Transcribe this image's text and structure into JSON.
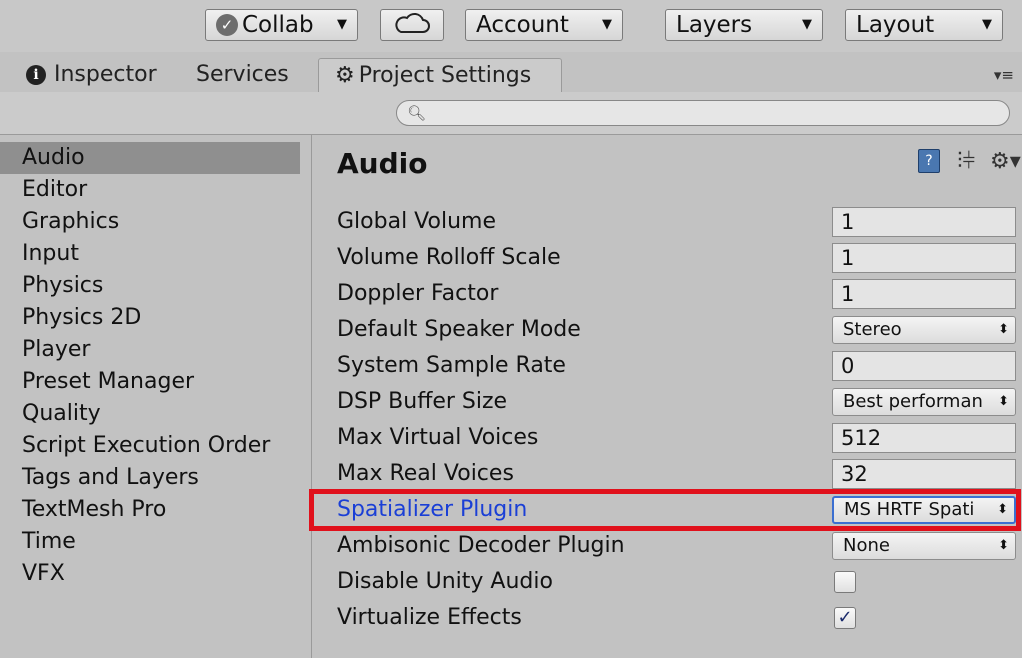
{
  "toolbar": {
    "collab_label": "Collab",
    "account_label": "Account",
    "layers_label": "Layers",
    "layout_label": "Layout"
  },
  "tabs": {
    "inspector": "Inspector",
    "services": "Services",
    "project_settings": "Project Settings"
  },
  "sidebar": {
    "items": [
      "Audio",
      "Editor",
      "Graphics",
      "Input",
      "Physics",
      "Physics 2D",
      "Player",
      "Preset Manager",
      "Quality",
      "Script Execution Order",
      "Tags and Layers",
      "TextMesh Pro",
      "Time",
      "VFX"
    ],
    "selected": "Audio"
  },
  "main": {
    "title": "Audio",
    "rows": {
      "global_volume": {
        "label": "Global Volume",
        "value": "1"
      },
      "volume_rolloff_scale": {
        "label": "Volume Rolloff Scale",
        "value": "1"
      },
      "doppler_factor": {
        "label": "Doppler Factor",
        "value": "1"
      },
      "default_speaker_mode": {
        "label": "Default Speaker Mode",
        "value": "Stereo"
      },
      "system_sample_rate": {
        "label": "System Sample Rate",
        "value": "0"
      },
      "dsp_buffer_size": {
        "label": "DSP Buffer Size",
        "value": "Best performan"
      },
      "max_virtual_voices": {
        "label": "Max Virtual Voices",
        "value": "512"
      },
      "max_real_voices": {
        "label": "Max Real Voices",
        "value": "32"
      },
      "spatializer_plugin": {
        "label": "Spatializer Plugin",
        "value": "MS HRTF Spati"
      },
      "ambisonic_decoder_plugin": {
        "label": "Ambisonic Decoder Plugin",
        "value": "None"
      },
      "disable_unity_audio": {
        "label": "Disable Unity Audio",
        "checked": false
      },
      "virtualize_effects": {
        "label": "Virtualize Effects",
        "checked": true
      }
    }
  },
  "colors": {
    "highlight_border": "#e0101b",
    "link_label": "#1a3fd6",
    "selected_sidebar": "#8f8f8f"
  },
  "icons": [
    "check-circle-icon",
    "chevron-down-icon",
    "cloud-icon",
    "info-icon",
    "gear-icon",
    "tab-menu-icon",
    "search-icon",
    "help-book-icon",
    "preset-sliders-icon",
    "settings-gear-icon",
    "dropdown-arrows-icon",
    "checkmark-icon"
  ]
}
